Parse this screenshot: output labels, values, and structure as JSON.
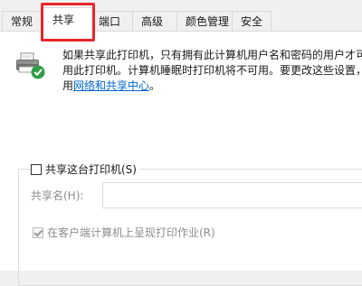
{
  "tabs": [
    {
      "label": "常规"
    },
    {
      "label": "共享"
    },
    {
      "label": "端口"
    },
    {
      "label": "高级"
    },
    {
      "label": "颜色管理"
    },
    {
      "label": "安全"
    }
  ],
  "active_tab": "共享",
  "highlight_color": "#e8262d",
  "printer_icon": "printer-shared-icon",
  "description": {
    "line1": "如果共享此打印机，只有拥有此计算机用户名和密码的用户才可",
    "line2": "用此打印机。计算机睡眠时打印机将不可用。要更改这些设置，",
    "line3_prefix": "用",
    "link_text": "网络和共享中心",
    "line3_suffix": "。"
  },
  "share_checkbox": {
    "label": "共享这台打印机(S)",
    "checked": false
  },
  "share_name": {
    "label": "共享名(H):",
    "value": ""
  },
  "render_jobs_checkbox": {
    "label": "在客户端计算机上呈现打印作业(R)",
    "checked": true,
    "disabled": true
  }
}
